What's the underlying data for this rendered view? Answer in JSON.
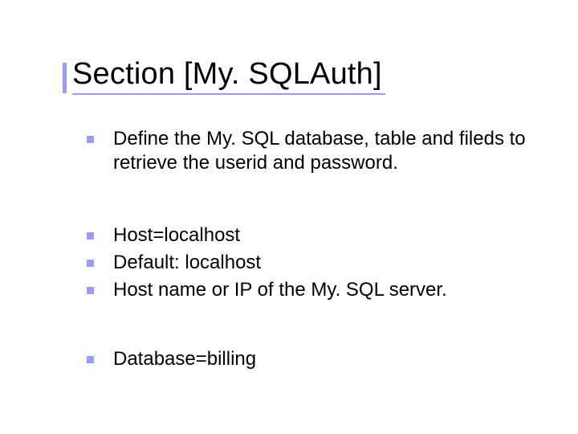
{
  "slide": {
    "title": "Section [My. SQLAuth]",
    "bullets": [
      "Define the My. SQL database, table and fileds to retrieve the userid and password.",
      "Host=localhost",
      "Default: localhost",
      "Host name or IP of the My. SQL server.",
      "Database=billing"
    ],
    "colors": {
      "accent": "#9a9aff"
    }
  }
}
